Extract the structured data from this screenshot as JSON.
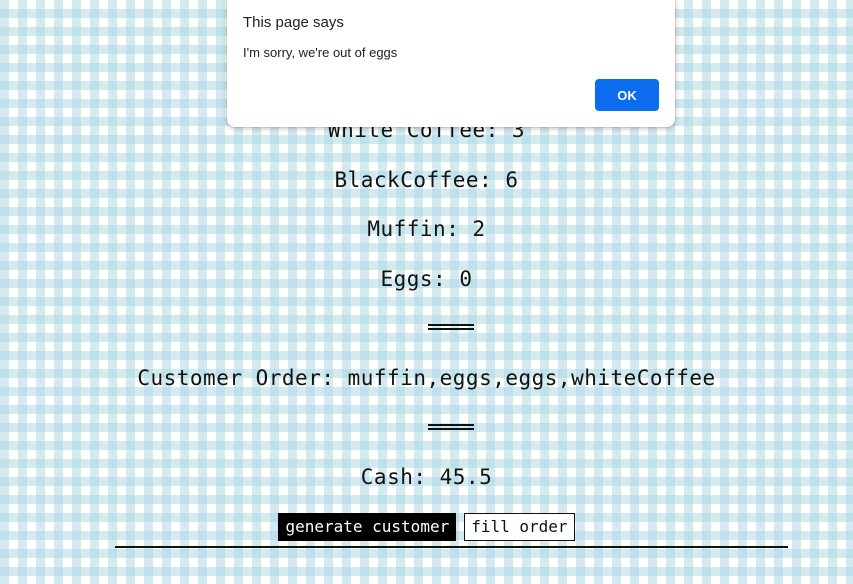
{
  "inventory": {
    "white_coffee": "White Coffee: 3",
    "black_coffee": "BlackCoffee: 6",
    "muffin": "Muffin: 2",
    "eggs": "Eggs: 0"
  },
  "order": {
    "text": "Customer Order: muffin,eggs,eggs,whiteCoffee"
  },
  "cash": {
    "text": "Cash: 45.5"
  },
  "buttons": {
    "generate_label": "generate customer",
    "fill_label": "fill order"
  },
  "alert": {
    "title": "This page says",
    "message": "I'm sorry, we're out of eggs",
    "ok_label": "OK",
    "ok_color": "#0b6cf0"
  },
  "colors": {
    "gingham": "#add8e4",
    "button_dark": "#000000"
  }
}
